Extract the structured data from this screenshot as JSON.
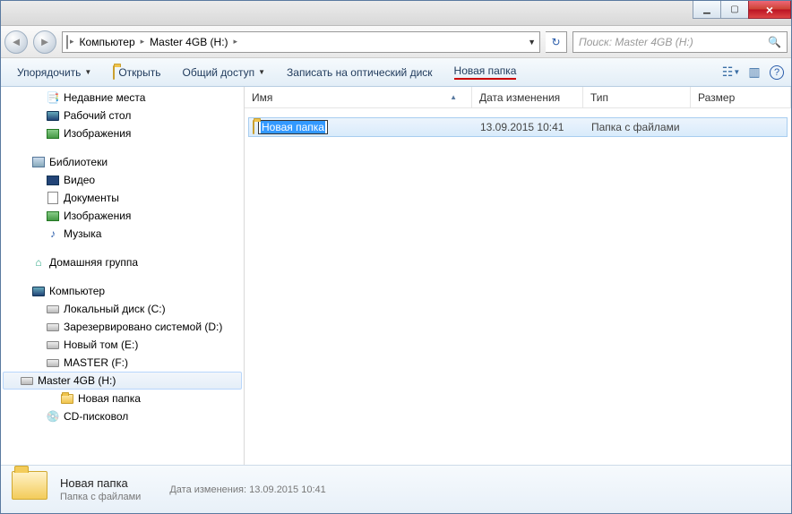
{
  "window_controls": {
    "min": "▁",
    "max": "▢",
    "close": "×"
  },
  "nav": {
    "back": "◄",
    "fwd": "►",
    "refresh": "↻"
  },
  "breadcrumb": {
    "sep": "▸",
    "items": [
      "Компьютер",
      "Master 4GB (H:)"
    ]
  },
  "search": {
    "placeholder": "Поиск: Master 4GB (H:)",
    "icon": "🔍"
  },
  "toolbar": {
    "organize": "Упорядочить",
    "open": "Открыть",
    "share": "Общий доступ",
    "burn": "Записать на оптический диск",
    "new_folder": "Новая папка",
    "help": "?"
  },
  "tree": {
    "recent": "Недавние места",
    "desktop": "Рабочий стол",
    "pictures1": "Изображения",
    "libraries": "Библиотеки",
    "video": "Видео",
    "documents": "Документы",
    "pictures2": "Изображения",
    "music": "Музыка",
    "homegroup": "Домашняя группа",
    "computer": "Компьютер",
    "drive_c": "Локальный диск (C:)",
    "drive_d": "Зарезервировано системой (D:)",
    "drive_e": "Новый том (E:)",
    "drive_f": "MASTER (F:)",
    "drive_h": "Master 4GB (H:)",
    "new_folder": "Новая папка",
    "cd": "CD-писковол"
  },
  "columns": {
    "name": "Имя",
    "date": "Дата изменения",
    "type": "Тип",
    "size": "Размер"
  },
  "files": [
    {
      "name": "Новая папка",
      "date": "13.09.2015 10:41",
      "type": "Папка с файлами"
    }
  ],
  "details": {
    "title": "Новая папка",
    "subtitle": "Папка с файлами",
    "date_label": "Дата изменения:",
    "date": "13.09.2015 10:41"
  }
}
